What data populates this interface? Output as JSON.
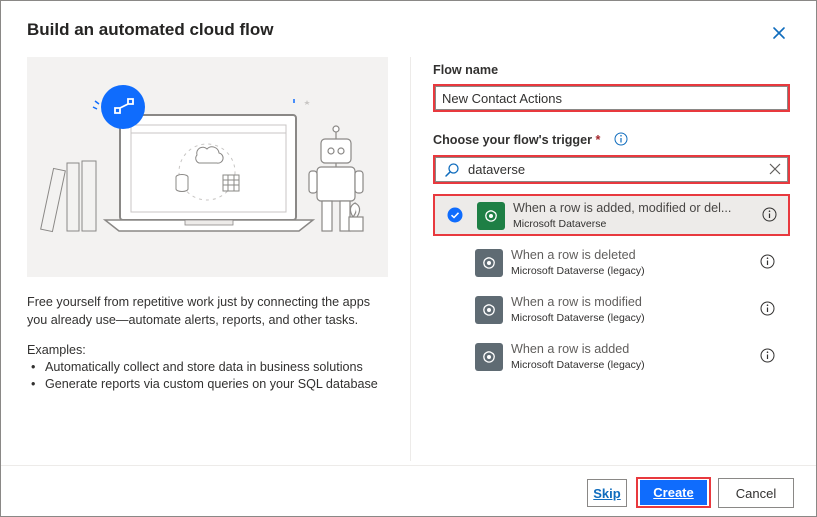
{
  "dialog": {
    "title": "Build an automated cloud flow",
    "close_icon": "close-icon"
  },
  "left": {
    "description": "Free yourself from repetitive work just by connecting the apps you already use—automate alerts, reports, and other tasks.",
    "examples_title": "Examples:",
    "examples": [
      "Automatically collect and store data in business solutions",
      "Generate reports via custom queries on your SQL database"
    ]
  },
  "form": {
    "flow_name_label": "Flow name",
    "flow_name_value": "New Contact Actions",
    "trigger_label": "Choose your flow's trigger",
    "required_mark": "*",
    "search_value": "dataverse"
  },
  "triggers": [
    {
      "name": "When a row is added, modified or del...",
      "connector": "Microsoft Dataverse",
      "selected": true
    },
    {
      "name": "When a row is deleted",
      "connector": "Microsoft Dataverse (legacy)",
      "selected": false
    },
    {
      "name": "When a row is modified",
      "connector": "Microsoft Dataverse (legacy)",
      "selected": false
    },
    {
      "name": "When a row is added",
      "connector": "Microsoft Dataverse (legacy)",
      "selected": false
    }
  ],
  "footer": {
    "skip_label": "Skip",
    "create_label": "Create",
    "cancel_label": "Cancel"
  },
  "colors": {
    "accent": "#0f6cfd",
    "highlight": "#e8393e",
    "dataverse_green": "#1e7f45",
    "legacy_gray": "#5f6b73"
  }
}
